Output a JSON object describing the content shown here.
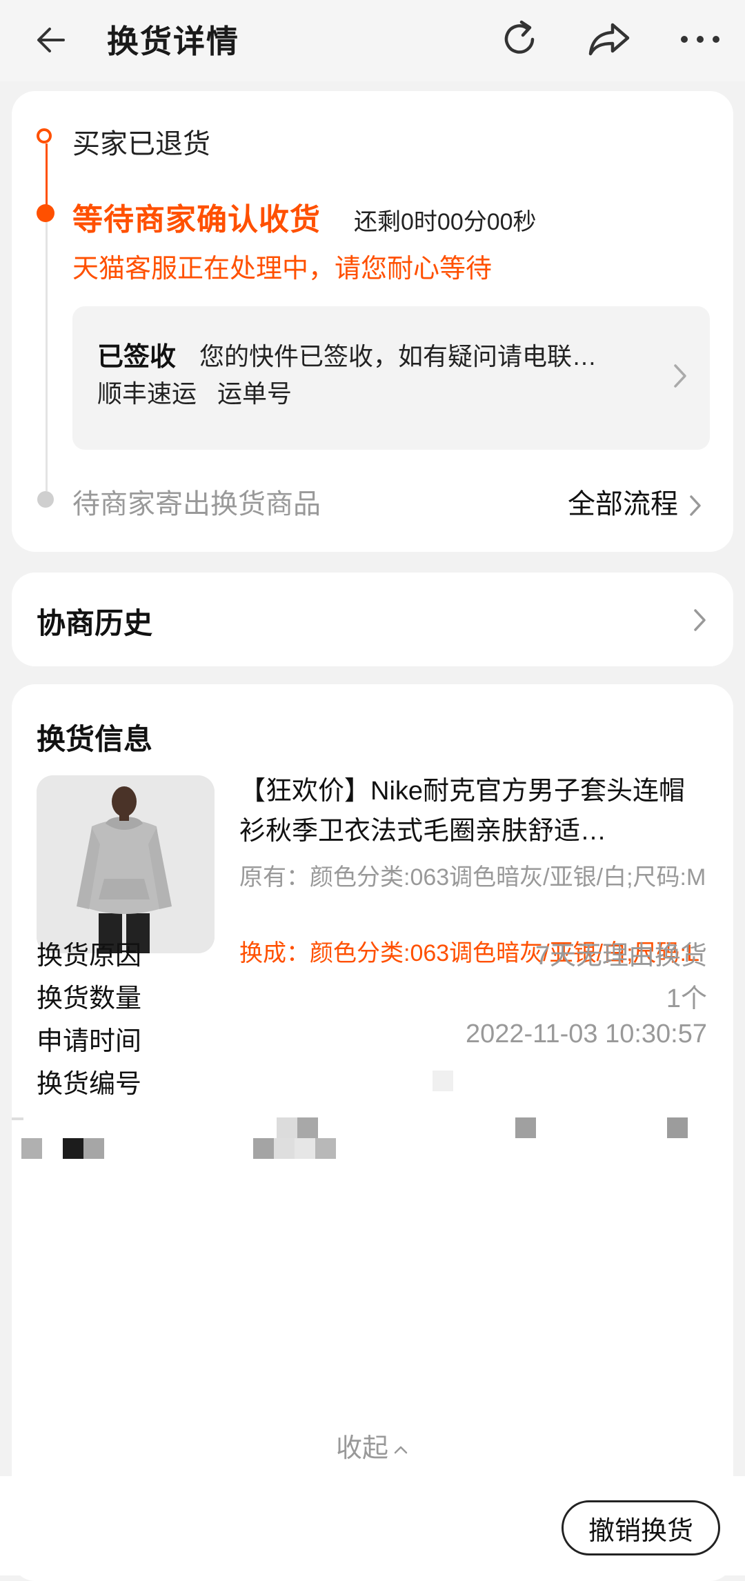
{
  "header": {
    "title": "换货详情"
  },
  "timeline": {
    "step1": "买家已退货",
    "step2_title": "等待商家确认收货",
    "step2_countdown": "还剩0时00分00秒",
    "step2_note": "天猫客服正在处理中，请您耐心等待",
    "logistics": {
      "status": "已签收",
      "desc": "您的快件已签收，如有疑问请电联…",
      "carrier": "顺丰速运",
      "waybill_label": "运单号"
    },
    "step3": "待商家寄出换货商品",
    "all_flow": "全部流程"
  },
  "history": {
    "title": "协商历史"
  },
  "exchange": {
    "title": "换货信息",
    "product_name": "【狂欢价】Nike耐克官方男子套头连帽衫秋季卫衣法式毛圈亲肤舒适…",
    "original": "原有：颜色分类:063调色暗灰/亚银/白;尺码:M",
    "new": "换成：颜色分类:063调色暗灰/亚银/白;尺码:L",
    "rows": [
      {
        "k": "换货原因",
        "v": "7天无理由换货"
      },
      {
        "k": "换货数量",
        "v": "1个"
      },
      {
        "k": "申请时间",
        "v": "2022-11-03 10:30:57"
      },
      {
        "k": "换货编号",
        "v": ""
      }
    ],
    "collapse": "收起"
  },
  "bottom": {
    "cancel": "撤销换货"
  },
  "colors": {
    "accent": "#ff5000",
    "muted": "#999999"
  }
}
